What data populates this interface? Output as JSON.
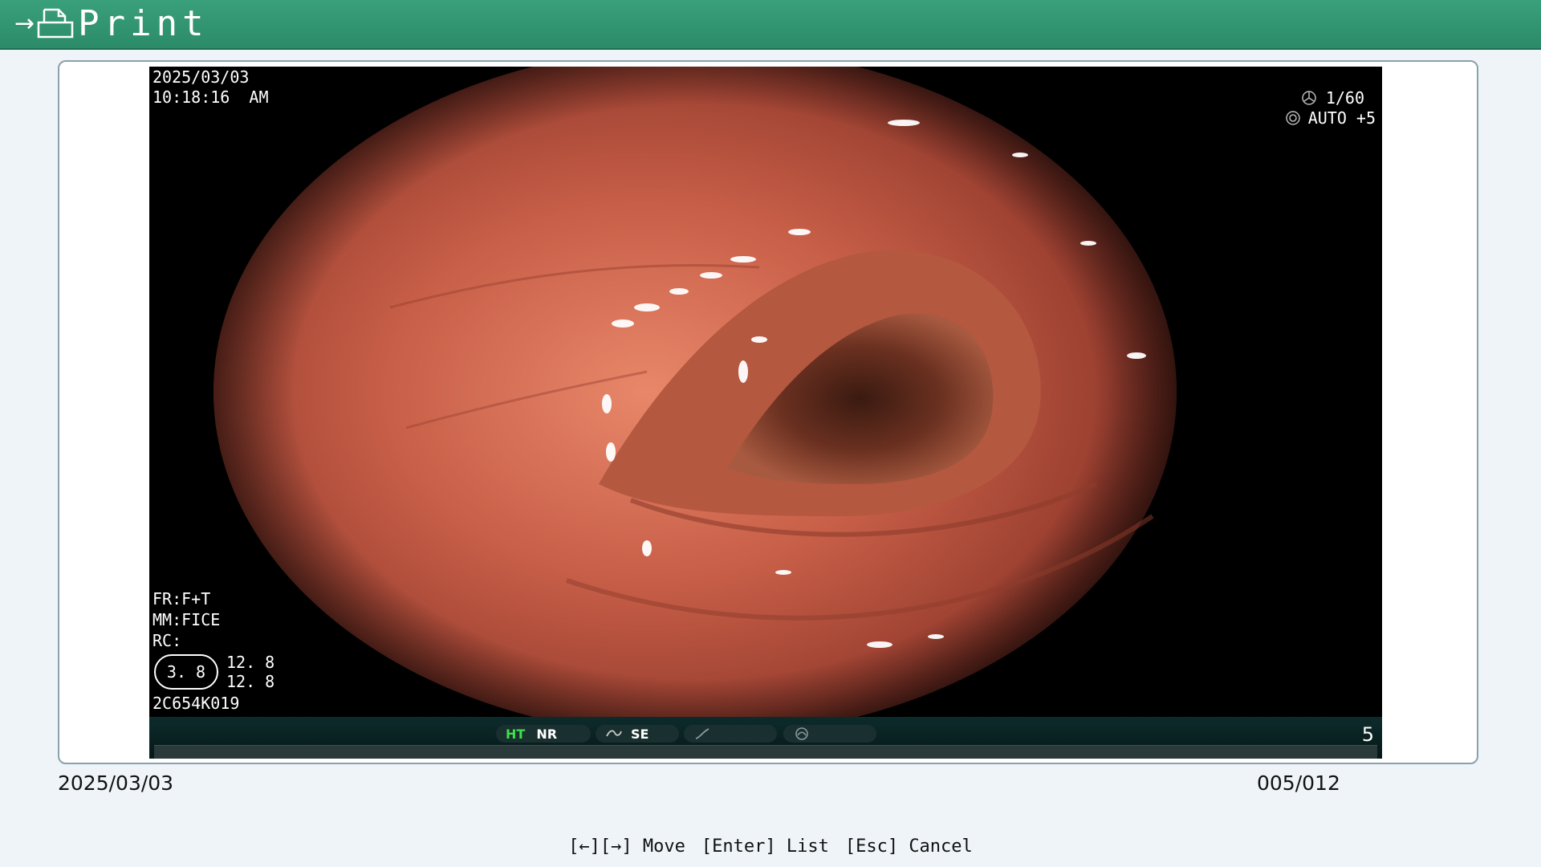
{
  "header": {
    "title": "Print",
    "icon": "printer-icon",
    "nav_glyph": "→"
  },
  "image_overlay": {
    "date": "2025/03/03",
    "time": "10:18:16  AM",
    "shutter": "1/60",
    "exposure": "AUTO +5",
    "fr": "FR:F+T",
    "mm": "MM:FICE",
    "rc": "RC:",
    "zoom": "3. 8",
    "value1": "12. 8",
    "value2": "12. 8",
    "device_id": "2C654K019"
  },
  "status_bar": {
    "ht": "HT",
    "nr": "NR",
    "se": "SE",
    "frame_number": "5"
  },
  "footer": {
    "date": "2025/03/03",
    "counter": "005/012"
  },
  "hints": {
    "move": "[←][→] Move",
    "list": "[Enter] List",
    "cancel": "[Esc] Cancel"
  },
  "colors": {
    "header_green": "#2b8b68",
    "ht_green": "#3fe04a"
  }
}
